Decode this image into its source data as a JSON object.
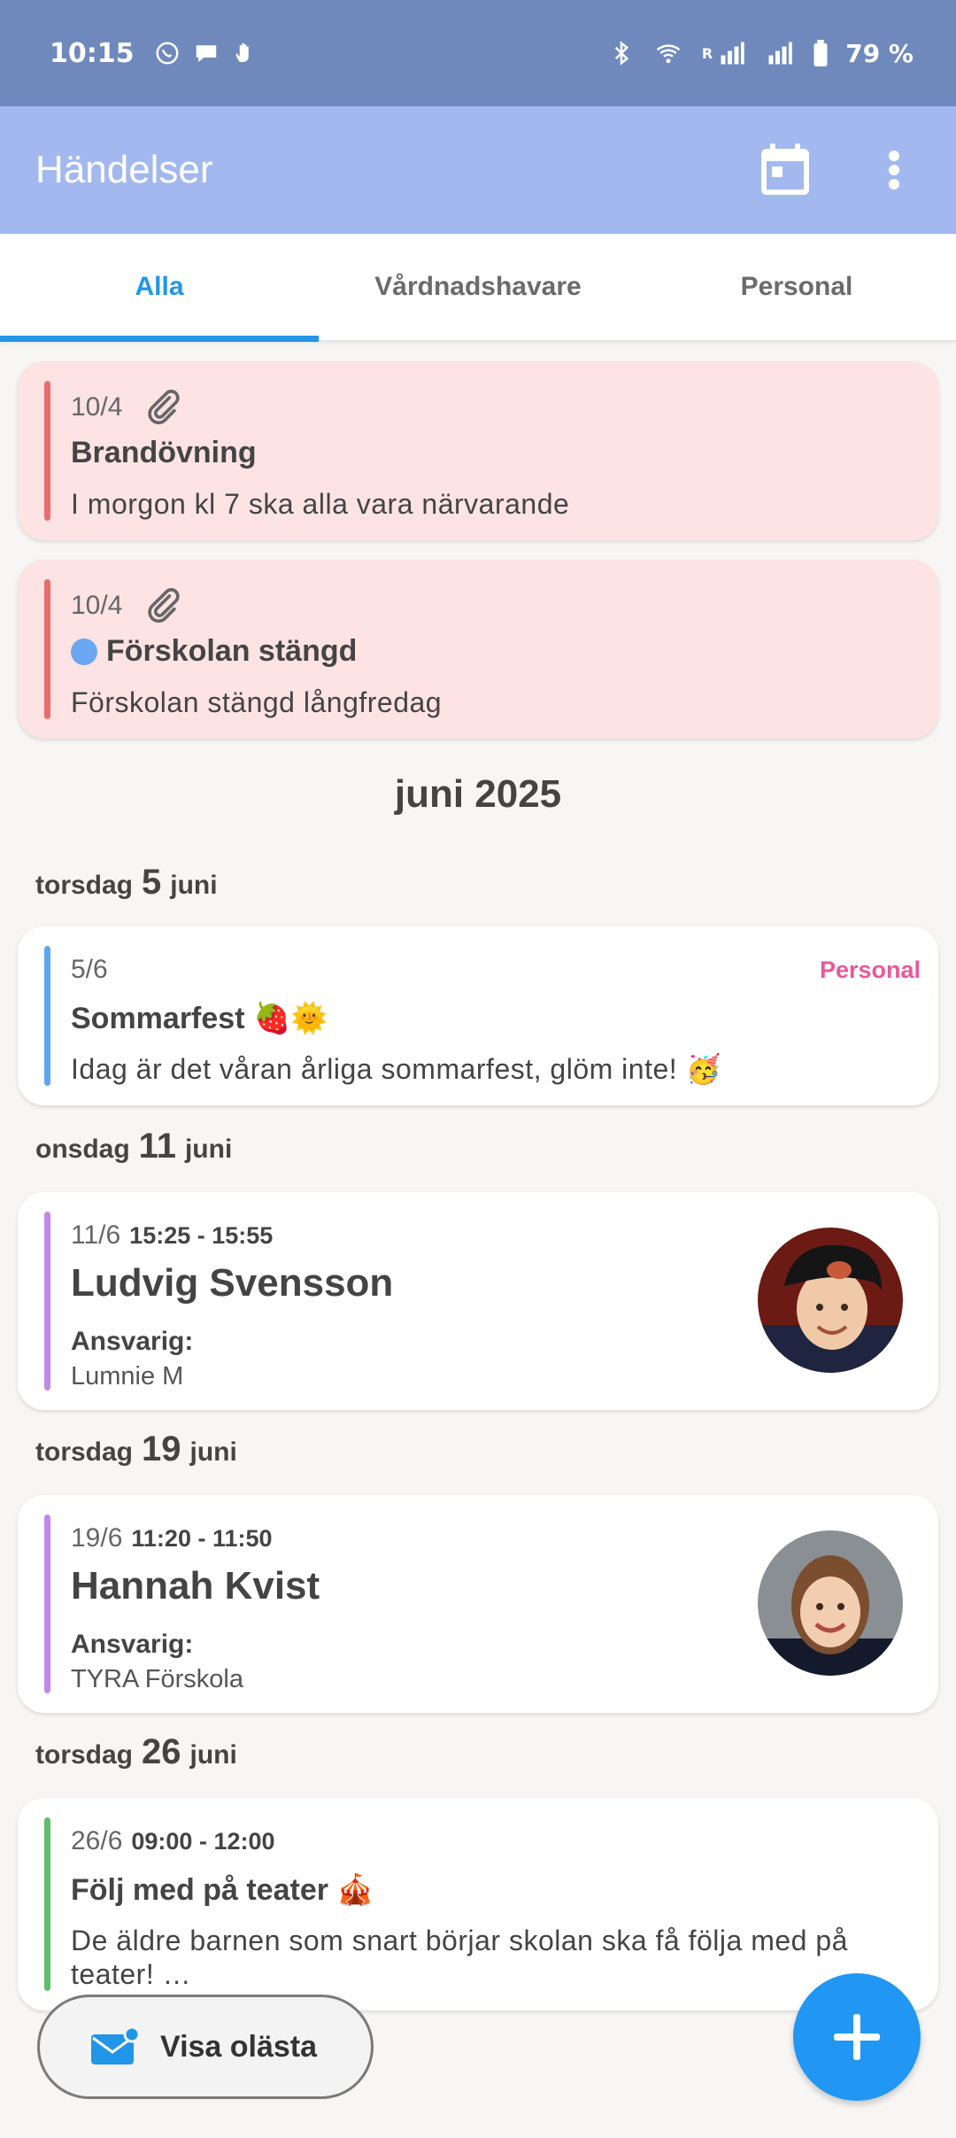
{
  "status_bar": {
    "time": "10:15",
    "battery": "79 %",
    "signal_label": "R"
  },
  "app_bar": {
    "title": "Händelser"
  },
  "tabs": [
    {
      "label": "Alla",
      "active": true
    },
    {
      "label": "Vårdnadshavare",
      "active": false
    },
    {
      "label": "Personal",
      "active": false
    }
  ],
  "pinned": [
    {
      "date": "10/4",
      "title": "Brandövning",
      "description": "I morgon kl 7 ska alla vara närvarande"
    },
    {
      "date": "10/4",
      "title": "Förskolan stängd",
      "description": "Förskolan stängd långfredag"
    }
  ],
  "month_header": "juni 2025",
  "days": [
    {
      "weekday": "torsdag",
      "day": "5",
      "month": "juni"
    },
    {
      "weekday": "onsdag",
      "day": "11",
      "month": "juni"
    },
    {
      "weekday": "torsdag",
      "day": "19",
      "month": "juni"
    },
    {
      "weekday": "torsdag",
      "day": "26",
      "month": "juni"
    }
  ],
  "events": [
    {
      "date": "5/6",
      "tag": "Personal",
      "title": "Sommarfest 🍓🌞",
      "description": "Idag är det våran årliga sommarfest, glöm inte! 🥳",
      "bar_color": "#5ea6ee"
    },
    {
      "date": "11/6",
      "time": "15:25 - 15:55",
      "title": "Ludvig Svensson",
      "responsible_label": "Ansvarig:",
      "responsible": "Lumnie M",
      "bar_color": "#c08ae6"
    },
    {
      "date": "19/6",
      "time": "11:20 - 11:50",
      "title": "Hannah Kvist",
      "responsible_label": "Ansvarig:",
      "responsible": "TYRA Förskola",
      "bar_color": "#c08ae6"
    },
    {
      "date": "26/6",
      "time": "09:00 - 12:00",
      "title": "Följ med på teater 🎪",
      "description": "De äldre barnen som snart börjar skolan ska få följa med på teater! …",
      "bar_color": "#5cbf6a"
    }
  ],
  "unread_button": {
    "label": "Visa olästa"
  },
  "colors": {
    "accent": "#2196e8",
    "pinned_bg": "#fde3e3",
    "pinned_bar": "#e96d6d",
    "tag": "#e65a9b",
    "appbar": "#a2b8ef",
    "statusbar": "#6f89bd"
  }
}
